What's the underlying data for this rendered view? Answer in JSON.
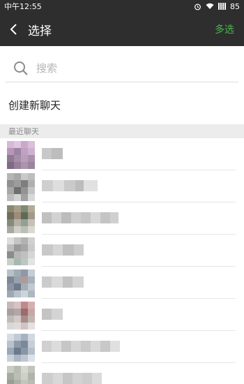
{
  "status_bar": {
    "time": "中午12:55",
    "battery": "85",
    "icons": [
      "alarm-icon",
      "wifi-icon",
      "signal-icon"
    ]
  },
  "header": {
    "title": "选择",
    "multi_select": "多选",
    "back_icon": "chevron-left-icon"
  },
  "search": {
    "placeholder": "搜索",
    "icon": "search-icon"
  },
  "create_chat": "创建新聊天",
  "recent_section": "最近聊天",
  "colors": {
    "header_bg": "#2e2e2e",
    "accent_green": "#4cb550",
    "section_bg": "#ececec"
  },
  "contacts_count_visible": 8
}
